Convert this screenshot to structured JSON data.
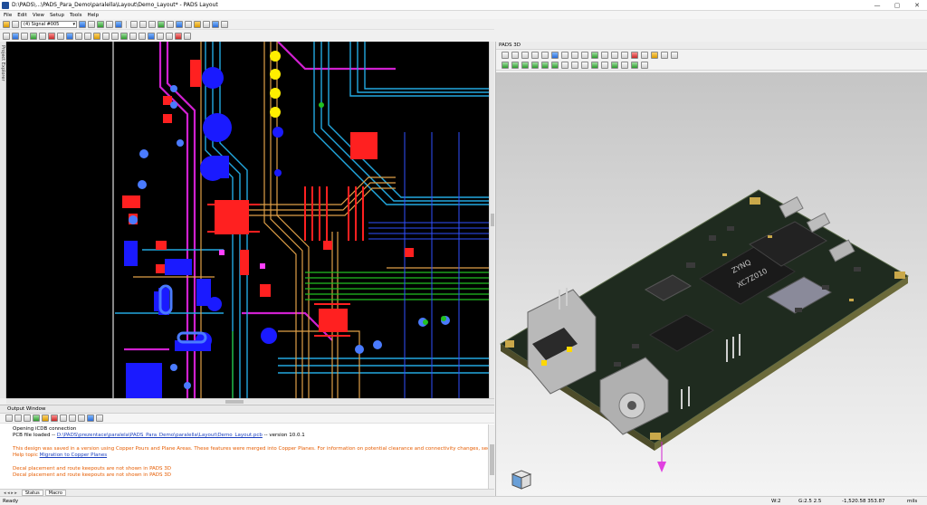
{
  "window": {
    "title": "D:\\PADS\\...\\PADS_Para_Demo\\paralella\\Layout\\Demo_Layout* - PADS Layout",
    "minimize": "—",
    "maximize": "▢",
    "close": "✕"
  },
  "menu": [
    "File",
    "Edit",
    "View",
    "Setup",
    "Tools",
    "Help"
  ],
  "toolbar": {
    "layer_select": "(4) Signal #005"
  },
  "project_explorer": {
    "label": "Project Explorer"
  },
  "output_window": {
    "title": "Output Window",
    "lines": {
      "l1": "Opening iCDB connection",
      "l2_prefix": "PCB file loaded -- ",
      "l2_link": "D:\\PADS\\prezentace\\paralela\\PADS_Para_Demo\\paralella\\Layout\\Demo_Layout.pcb",
      "l2_suffix": " -- version 10.0.1",
      "l3": "This design was saved in a version using Copper Pours and Plane Areas. These features were merged into Copper Planes. For information on potential clearance and connectivity changes, see",
      "l4_prefix": "Help topic ",
      "l4_link": "Migration to Copper Planes",
      "l5": "Decal placement and route keepouts are not shown in PADS 3D",
      "l6": "Decal placement and route keepouts are not shown in PADS 3D"
    }
  },
  "bottom_tabs": {
    "nav": "◂ ◂ ▸ ▸",
    "status": "Status",
    "macro": "Macro"
  },
  "pads3d": {
    "title": "PADS 3D",
    "chip_label_1": "ZYNQ",
    "chip_label_2": "XC7Z010"
  },
  "statusbar": {
    "ready": "Ready",
    "w": "W:2",
    "grid": "G:2.5 2.5",
    "coords": "-1,520.58 353.87",
    "units": "mils"
  },
  "colors": {
    "pcb_background": "#000000",
    "pad_red": "#ff2020",
    "via_blue": "#1a1aff",
    "trace_orange": "#e8a040",
    "trace_green": "#22c022",
    "trace_magenta": "#d020d0",
    "trace_cyan": "#20b0e0",
    "board_3d": "#1e2a1e"
  }
}
